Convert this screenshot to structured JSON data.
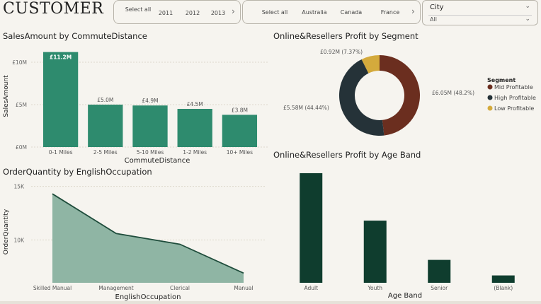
{
  "page": {
    "title": "CUSTOMER"
  },
  "year_slicer": {
    "options": [
      "Select all",
      "2011",
      "2012",
      "2013"
    ],
    "more": "›"
  },
  "country_slicer": {
    "options": [
      "Select all",
      "Australia",
      "Canada",
      "France"
    ],
    "more": "›"
  },
  "city_dropdown": {
    "label": "City",
    "value": "All"
  },
  "colors": {
    "green": "#2e8b6e",
    "dark_green": "#0f3d2e",
    "area_fill": "#8fb5a4",
    "area_line": "#1f4d3c",
    "mid": "#6b2e1f",
    "high": "#253238",
    "low": "#d4aa3c"
  },
  "chart_data": [
    {
      "type": "bar",
      "title": "SalesAmount by CommuteDistance",
      "xlabel": "CommuteDistance",
      "ylabel": "SalesAmount",
      "categories": [
        "0-1 Miles",
        "2-5 Miles",
        "5-10 Miles",
        "1-2 Miles",
        "10+ Miles"
      ],
      "values": [
        11.2,
        5.0,
        4.9,
        4.5,
        3.8
      ],
      "data_labels": [
        "£11.2M",
        "£5.0M",
        "£4.9M",
        "£4.5M",
        "£3.8M"
      ],
      "ylim": [
        0,
        12
      ],
      "yticks": [
        0,
        5,
        10
      ],
      "ytick_labels": [
        "£0M",
        "£5M",
        "£10M"
      ]
    },
    {
      "type": "pie",
      "title": "Online&Resellers Profit by Segment",
      "legend_title": "Segment",
      "legend_position": "right",
      "slices": [
        {
          "name": "Mid Profitable",
          "value": 6.05,
          "label": "£6.05M (48.2%)"
        },
        {
          "name": "High Profitable",
          "value": 5.58,
          "label": "£5.58M (44.44%)"
        },
        {
          "name": "Low Profitable",
          "value": 0.92,
          "label": "£0.92M (7.37%)"
        }
      ]
    },
    {
      "type": "area",
      "title": "OrderQuantity by EnglishOccupation",
      "xlabel": "EnglishOccupation",
      "ylabel": "OrderQuantity",
      "categories": [
        "Skilled Manual",
        "Management",
        "Clerical",
        "Manual"
      ],
      "values": [
        14300,
        10600,
        9600,
        6900
      ],
      "ylim": [
        6000,
        15500
      ],
      "yticks": [
        10000,
        15000
      ],
      "ytick_labels": [
        "10K",
        "15K"
      ]
    },
    {
      "type": "bar",
      "title": "Online&Resellers Profit by Age Band",
      "xlabel": "Age Band",
      "categories": [
        "Adult",
        "Youth",
        "Senior",
        "(Blank)"
      ],
      "values": [
        6.7,
        3.8,
        1.4,
        0.45
      ],
      "ylim": [
        0,
        7
      ]
    }
  ]
}
